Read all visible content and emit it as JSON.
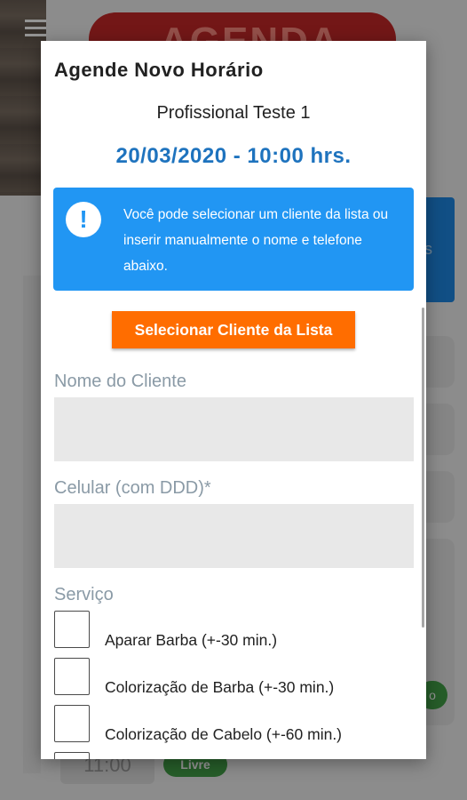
{
  "background": {
    "header_text": "AGENDA",
    "slot_time": "11:00",
    "slot_status": "Livre",
    "side_badge": "o",
    "side_panel_text": "s"
  },
  "dialog": {
    "title": "Agende Novo Horário",
    "professional": "Profissional Teste 1",
    "datetime": "20/03/2020 - 10:00 hrs.",
    "info_icon": "exclamation-icon",
    "info_text": "Você pode selecionar um cliente da lista ou inserir manualmente o nome e telefone abaixo.",
    "select_button": "Selecionar Cliente da Lista",
    "client_name_label": "Nome do Cliente",
    "client_name_value": "",
    "phone_label": "Celular (com DDD)*",
    "phone_value": "",
    "service_label": "Serviço",
    "services": [
      {
        "label": "Aparar Barba (+-30 min.)",
        "checked": false
      },
      {
        "label": "Colorização de Barba (+-30 min.)",
        "checked": false
      },
      {
        "label": "Colorização de Cabelo (+-60 min.)",
        "checked": false
      }
    ]
  },
  "colors": {
    "accent_blue": "#2196f3",
    "date_blue": "#1e73be",
    "button_orange": "#ff6d00",
    "status_green": "#43a047"
  }
}
